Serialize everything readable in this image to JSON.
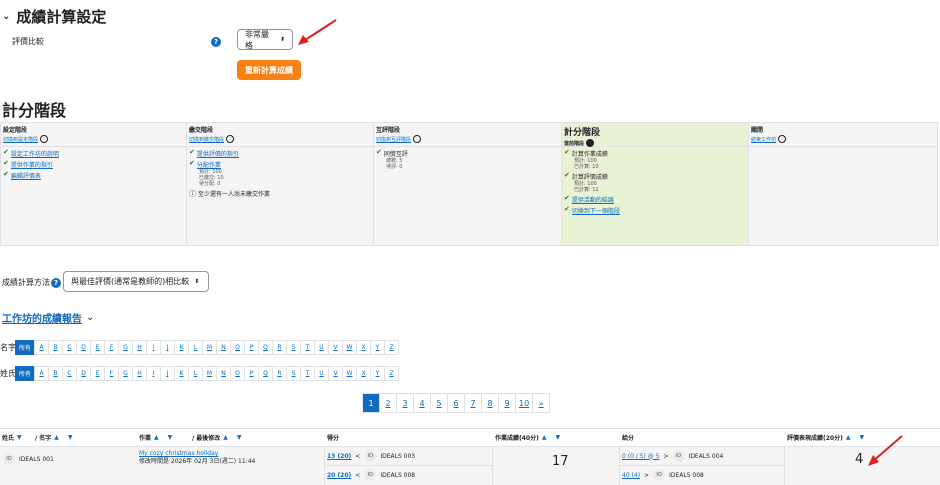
{
  "section1": {
    "title": "成績計算設定",
    "compare_label": "評價比較",
    "compare_value": "非常嚴格",
    "recalc_button": "重新計算成績"
  },
  "section2": {
    "title": "計分階段"
  },
  "phases": [
    {
      "title": "設定階段",
      "switch": "切換到設定階段",
      "tasks": [
        {
          "label": "設定工作坊的說明",
          "details": []
        },
        {
          "label": "提供作業的指引",
          "details": []
        },
        {
          "label": "編輯評價表",
          "details": []
        }
      ]
    },
    {
      "title": "繳交階段",
      "switch": "切換到繳交階段",
      "tasks": [
        {
          "label": "提供評價的指引",
          "details": []
        },
        {
          "label": "分配作業",
          "details": [
            "預計: 100",
            "已繳交: 10",
            "待分配: 0"
          ]
        }
      ],
      "info": "至少還有一人尚未繳交作業"
    },
    {
      "title": "互評階段",
      "switch": "切換到互評階段",
      "tasks": [
        {
          "label": "同儕互評",
          "details": [
            "總數: 5",
            "待評: 0"
          ]
        }
      ]
    },
    {
      "title": "計分階段",
      "switch": "當前階段",
      "tasks": [
        {
          "label": "計算作業成績",
          "details": [
            "預計: 100",
            "已計算: 10"
          ]
        },
        {
          "label": "計算評價成績",
          "details": [
            "預計: 100",
            "已計算: 11"
          ]
        },
        {
          "label": "提供活動的結論",
          "details": []
        },
        {
          "label": "切換到下一個階段",
          "details": []
        }
      ]
    },
    {
      "title": "關閉",
      "switch": "結束工作坊",
      "tasks": []
    }
  ],
  "method": {
    "label": "成績計算方法",
    "value": "與最佳評價(通常是教師的)相比較"
  },
  "report": {
    "title": "工作坊的成績報告"
  },
  "filters": {
    "first_label": "名字",
    "last_label": "姓氏",
    "all": "所有",
    "letters": [
      "A",
      "B",
      "C",
      "D",
      "E",
      "F",
      "G",
      "H",
      "I",
      "J",
      "K",
      "L",
      "M",
      "N",
      "O",
      "P",
      "Q",
      "R",
      "S",
      "T",
      "U",
      "V",
      "W",
      "X",
      "Y",
      "Z"
    ]
  },
  "pagination": [
    "1",
    "2",
    "3",
    "4",
    "5",
    "6",
    "7",
    "8",
    "9",
    "10",
    "»"
  ],
  "table": {
    "headers": {
      "last": "姓氏",
      "first": "/ 名字",
      "submission": "作業",
      "modified": "/ 最後修改",
      "received": "得分",
      "sub_grade": "作業成績(40分)",
      "given": "給分",
      "assess_grade": "評價表現成績(20分)"
    },
    "row": {
      "avatar": "IO",
      "name": "IDEALS 001",
      "submission_title": "My cozy christmas holiday",
      "submission_date": "修改時間是 2026年 02月 3日(週二) 11:44",
      "received": [
        {
          "score": "13 (20)",
          "by": "IDEALS 003"
        },
        {
          "score": "20 (20)",
          "by": "IDEALS 008"
        }
      ],
      "sub_grade": "17",
      "given": [
        {
          "score": "0 (0 / 5) @ 5",
          "to": "IDEALS 004"
        },
        {
          "score": "40 (4)",
          "to": "IDEALS 008"
        }
      ],
      "assess_grade": "4"
    }
  },
  "colors": {
    "link": "#0f6cbf",
    "orange": "#f98012",
    "active_phase": "#e7f3d4",
    "annotation": "#e02020"
  }
}
